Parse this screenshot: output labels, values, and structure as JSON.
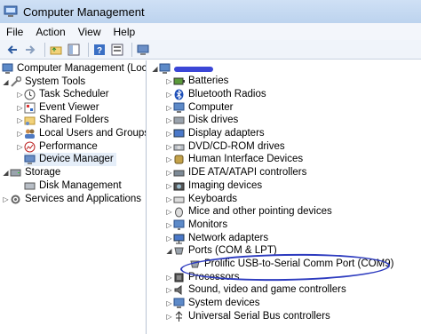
{
  "window": {
    "title": "Computer Management"
  },
  "menu": [
    "File",
    "Action",
    "View",
    "Help"
  ],
  "toolbar": {
    "icons": [
      "back-arrow-icon",
      "forward-arrow-icon",
      "up-folder-icon",
      "show-hide-tree-icon",
      "help-icon",
      "properties-icon",
      "device-manager-icon"
    ]
  },
  "tree": {
    "root": "Computer Management (Local",
    "system_tools": "System Tools",
    "task_scheduler": "Task Scheduler",
    "event_viewer": "Event Viewer",
    "shared_folders": "Shared Folders",
    "local_users": "Local Users and Groups",
    "performance": "Performance",
    "device_manager": "Device Manager",
    "storage": "Storage",
    "disk_management": "Disk Management",
    "services": "Services and Applications"
  },
  "devices": {
    "computer_name": "",
    "categories": [
      "Batteries",
      "Bluetooth Radios",
      "Computer",
      "Disk drives",
      "Display adapters",
      "DVD/CD-ROM drives",
      "Human Interface Devices",
      "IDE ATA/ATAPI controllers",
      "Imaging devices",
      "Keyboards",
      "Mice and other pointing devices",
      "Monitors",
      "Network adapters",
      "Ports (COM & LPT)",
      "Prolific USB-to-Serial Comm Port (COM9)",
      "Processors",
      "Sound, video and game controllers",
      "System devices",
      "Universal Serial Bus controllers"
    ]
  },
  "colors": {
    "title_bg": "#c4d8f0",
    "selection": "#e5eef9",
    "annotation": "#2d3bbf",
    "redacted": "#3b46d6"
  }
}
